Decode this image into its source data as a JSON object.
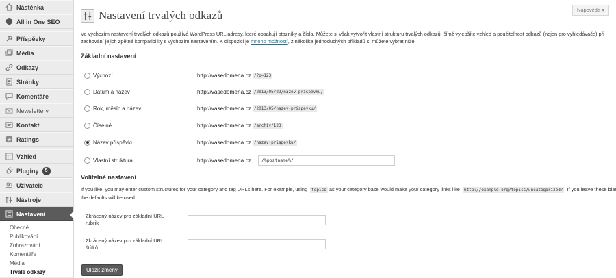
{
  "sidebar": {
    "items": [
      {
        "label": "Nástěnka",
        "icon": "dashboard-icon"
      },
      {
        "label": "All in One SEO",
        "icon": "seo-icon"
      },
      {
        "label": "Příspěvky",
        "icon": "pin-icon"
      },
      {
        "label": "Média",
        "icon": "media-icon"
      },
      {
        "label": "Odkazy",
        "icon": "link-icon"
      },
      {
        "label": "Stránky",
        "icon": "page-icon"
      },
      {
        "label": "Komentáře",
        "icon": "comment-icon"
      },
      {
        "label": "Newslettery",
        "icon": "mail-icon"
      },
      {
        "label": "Kontakt",
        "icon": "contact-icon"
      },
      {
        "label": "Ratings",
        "icon": "star-icon"
      },
      {
        "label": "Vzhled",
        "icon": "appearance-icon"
      },
      {
        "label": "Pluginy",
        "icon": "plugin-icon",
        "badge": "5"
      },
      {
        "label": "Uživatelé",
        "icon": "users-icon"
      },
      {
        "label": "Nástroje",
        "icon": "tools-icon"
      },
      {
        "label": "Nastavení",
        "icon": "settings-icon"
      }
    ],
    "submenu": [
      "Obecné",
      "Publikování",
      "Zobrazování",
      "Komentáře",
      "Média",
      "Trvalé odkazy"
    ]
  },
  "help_tab": "Nápověda ▾",
  "page_title": "Nastavení trvalých odkazů",
  "intro": {
    "text_before": "Ve výchozím nastavení trvalých odkazů používá WordPress URL adresy, které obsahují otazníky a čísla. Můžete si však vytvořit vlastní strukturu trvalých odkazů, čímž vylepšíte vzhled a použitelnost odkazů (nejen pro vyhledávače) při zachování jejich zpětné kompatibility s výchozím nastavením. K dispozici je ",
    "link": "mnoho možností",
    "text_after": ", z několika jednoduchých příkladů si můžete vybrat níže."
  },
  "basic_settings_title": "Základní nastavení",
  "permalink_options": [
    {
      "label": "Výchozí",
      "base": "http://vasedomena.cz",
      "code": "/?p=123",
      "checked": false
    },
    {
      "label": "Datum a název",
      "base": "http://vasedomena.cz",
      "code": "/2013/05/29/nazev-prispevku/",
      "checked": false
    },
    {
      "label": "Rok, měsíc a název",
      "base": "http://vasedomena.cz",
      "code": "/2013/05/nazev-prispevku/",
      "checked": false
    },
    {
      "label": "Číselné",
      "base": "http://vasedomena.cz",
      "code": "/archiv/123",
      "checked": false
    },
    {
      "label": "Název příspěvku",
      "base": "http://vasedomena.cz",
      "code": "/nazev-prispevku/",
      "checked": true
    },
    {
      "label": "Vlastní struktura",
      "base": "http://vasedomena.cz",
      "input_value": "/%postname%/",
      "checked": false
    }
  ],
  "optional_title": "Volitelné nastavení",
  "optional_desc": {
    "part1": "If you like, you may enter custom structures for your category and tag URLs here. For example, using ",
    "code1": "topics",
    "part2": " as your category base would make your category links like ",
    "code2": "http://example.org/topics/uncategorized/",
    "part3": ". If you leave these blank the defaults will be used."
  },
  "fields": [
    {
      "label": "Zkrácený název pro základní URL rubrik",
      "value": ""
    },
    {
      "label": "Zkrácený název pro základní URL štítků",
      "value": ""
    }
  ],
  "save_label": "Uložit změny"
}
